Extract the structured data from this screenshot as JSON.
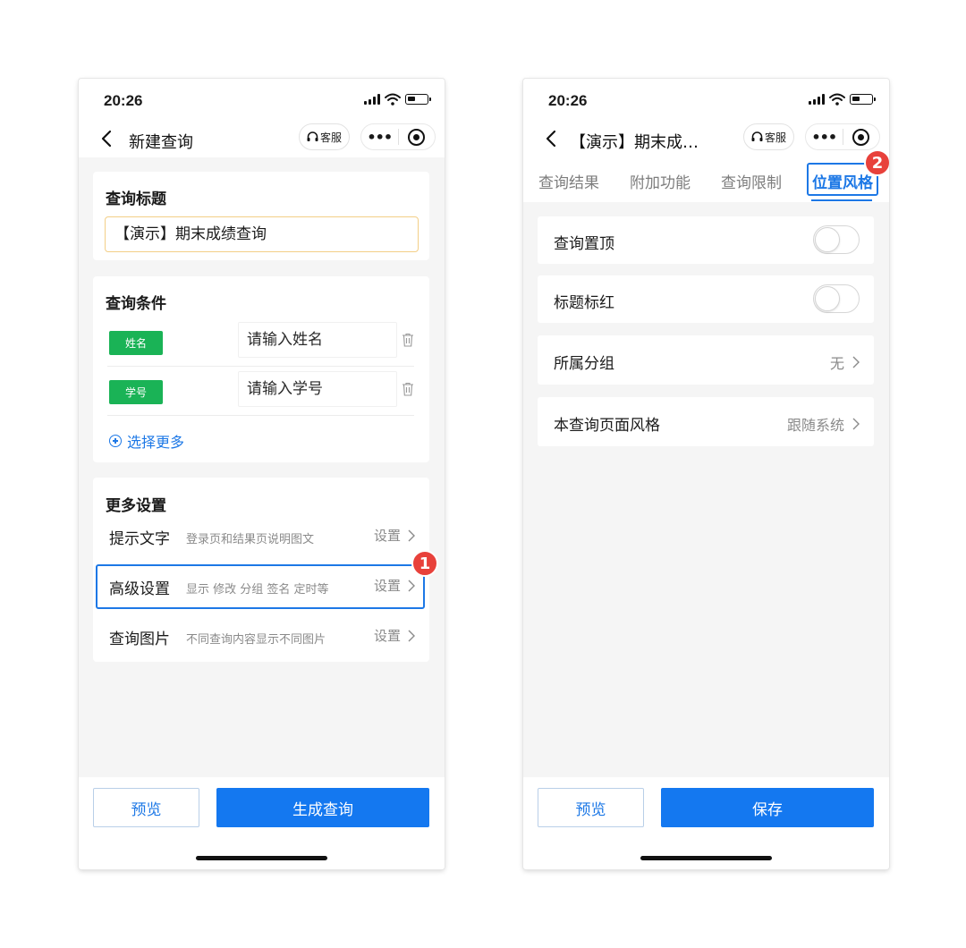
{
  "colors": {
    "accent": "#1478f0",
    "tag_green": "#1ab356",
    "badge_red": "#e8413b",
    "input_border": "#f3cf87"
  },
  "left": {
    "status": {
      "time": "20:26"
    },
    "nav": {
      "title": "新建查询",
      "service_label": "客服"
    },
    "title_card": {
      "heading": "查询标题",
      "input_value": "【演示】期末成绩查询"
    },
    "conditions": {
      "heading": "查询条件",
      "rows": [
        {
          "tag": "姓名",
          "placeholder": "请输入姓名"
        },
        {
          "tag": "学号",
          "placeholder": "请输入学号"
        }
      ],
      "select_more": "选择更多"
    },
    "more_settings": {
      "heading": "更多设置",
      "rows": [
        {
          "name": "提示文字",
          "desc": "登录页和结果页说明图文",
          "action": "设置"
        },
        {
          "name": "高级设置",
          "desc": "显示 修改 分组 签名 定时等",
          "action": "设置"
        },
        {
          "name": "查询图片",
          "desc": "不同查询内容显示不同图片",
          "action": "设置"
        }
      ]
    },
    "badge": "1",
    "buttons": {
      "preview": "预览",
      "primary": "生成查询"
    }
  },
  "right": {
    "status": {
      "time": "20:26"
    },
    "nav": {
      "title": "【演示】期末成…",
      "service_label": "客服"
    },
    "tabs": [
      "查询结果",
      "附加功能",
      "查询限制",
      "位置风格"
    ],
    "active_tab": "位置风格",
    "badge": "2",
    "rows": [
      {
        "label": "查询置顶",
        "toggle": false
      },
      {
        "label": "标题标红",
        "toggle": false
      },
      {
        "label": "所属分组",
        "value": "无"
      },
      {
        "label": "本查询页面风格",
        "value": "跟随系统"
      }
    ],
    "buttons": {
      "preview": "预览",
      "primary": "保存"
    }
  }
}
